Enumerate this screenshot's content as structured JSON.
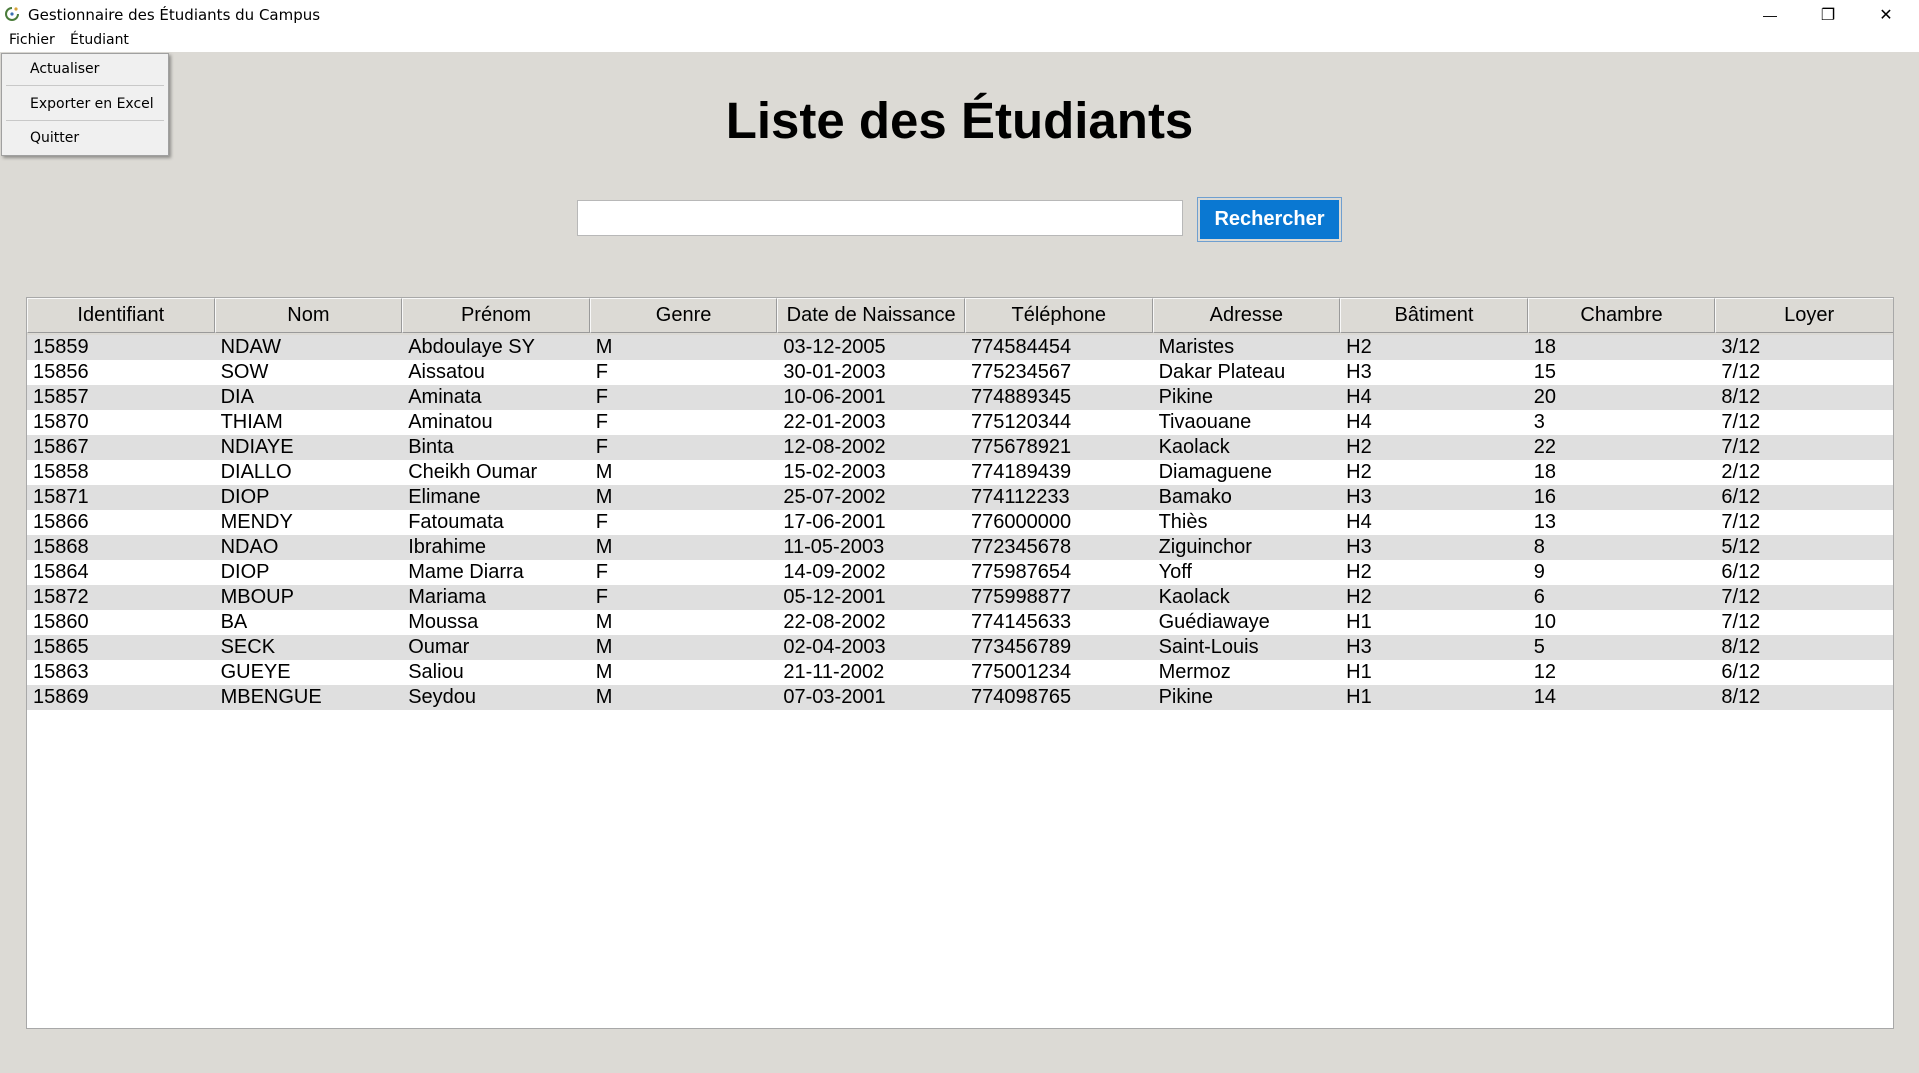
{
  "window": {
    "title": "Gestionnaire des Étudiants du Campus",
    "minimize_glyph": "—",
    "restore_glyph": "❐",
    "close_glyph": "✕"
  },
  "menubar": {
    "items": [
      {
        "label": "Fichier"
      },
      {
        "label": "Étudiant"
      }
    ]
  },
  "dropdown": {
    "items": [
      {
        "label": "Actualiser"
      },
      {
        "label": "Exporter en Excel"
      },
      {
        "label": "Quitter"
      }
    ]
  },
  "main": {
    "title": "Liste des Étudiants",
    "search": {
      "value": "",
      "placeholder": ""
    },
    "search_button": "Rechercher"
  },
  "table": {
    "columns": [
      "Identifiant",
      "Nom",
      "Prénom",
      "Genre",
      "Date de Naissance",
      "Téléphone",
      "Adresse",
      "Bâtiment",
      "Chambre",
      "Loyer"
    ],
    "rows": [
      [
        "15859",
        "NDAW",
        "Abdoulaye SY",
        "M",
        "03-12-2005",
        "774584454",
        "Maristes",
        "H2",
        "18",
        "3/12"
      ],
      [
        "15856",
        "SOW",
        "Aissatou",
        "F",
        "30-01-2003",
        "775234567",
        "Dakar Plateau",
        "H3",
        "15",
        "7/12"
      ],
      [
        "15857",
        "DIA",
        "Aminata",
        "F",
        "10-06-2001",
        "774889345",
        "Pikine",
        "H4",
        "20",
        "8/12"
      ],
      [
        "15870",
        "THIAM",
        "Aminatou",
        "F",
        "22-01-2003",
        "775120344",
        "Tivaouane",
        "H4",
        "3",
        "7/12"
      ],
      [
        "15867",
        "NDIAYE",
        "Binta",
        "F",
        "12-08-2002",
        "775678921",
        "Kaolack",
        "H2",
        "22",
        "7/12"
      ],
      [
        "15858",
        "DIALLO",
        "Cheikh Oumar",
        "M",
        "15-02-2003",
        "774189439",
        "Diamaguene",
        "H2",
        "18",
        "2/12"
      ],
      [
        "15871",
        "DIOP",
        "Elimane",
        "M",
        "25-07-2002",
        "774112233",
        "Bamako",
        "H3",
        "16",
        "6/12"
      ],
      [
        "15866",
        "MENDY",
        "Fatoumata",
        "F",
        "17-06-2001",
        "776000000",
        "Thiès",
        "H4",
        "13",
        "7/12"
      ],
      [
        "15868",
        "NDAO",
        "Ibrahime",
        "M",
        "11-05-2003",
        "772345678",
        "Ziguinchor",
        "H3",
        "8",
        "5/12"
      ],
      [
        "15864",
        "DIOP",
        "Mame Diarra",
        "F",
        "14-09-2002",
        "775987654",
        "Yoff",
        "H2",
        "9",
        "6/12"
      ],
      [
        "15872",
        "MBOUP",
        "Mariama",
        "F",
        "05-12-2001",
        "775998877",
        "Kaolack",
        "H2",
        "6",
        "7/12"
      ],
      [
        "15860",
        "BA",
        "Moussa",
        "M",
        "22-08-2002",
        "774145633",
        "Guédiawaye",
        "H1",
        "10",
        "7/12"
      ],
      [
        "15865",
        "SECK",
        "Oumar",
        "M",
        "02-04-2003",
        "773456789",
        "Saint-Louis",
        "H3",
        "5",
        "8/12"
      ],
      [
        "15863",
        "GUEYE",
        "Saliou",
        "M",
        "21-11-2002",
        "775001234",
        "Mermoz",
        "H1",
        "12",
        "6/12"
      ],
      [
        "15869",
        "MBENGUE",
        "Seydou",
        "M",
        "07-03-2001",
        "774098765",
        "Pikine",
        "H1",
        "14",
        "8/12"
      ]
    ]
  },
  "colors": {
    "window_bg": "#dcdad5",
    "accent_button": "#0a78d2",
    "row_alt": "#dfdfdf"
  }
}
